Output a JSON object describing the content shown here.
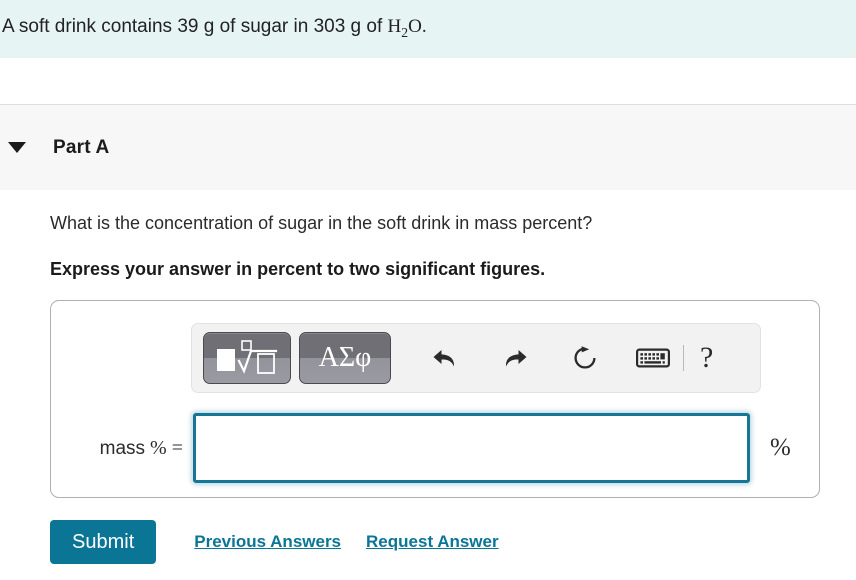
{
  "problem": {
    "text_before": "A soft drink contains 39 g of sugar in 303 g of ",
    "formula_h": "H",
    "formula_sub": "2",
    "formula_o": "O.",
    "full_text": "A soft drink contains 39 g of sugar in 303 g of H2O.",
    "sugar_mass_g": 39,
    "water_mass_g": 303,
    "banner_color": "#e7f4f4"
  },
  "part": {
    "title": "Part A",
    "toggle_icon": "triangle-down-icon",
    "expanded": true,
    "header_color": "#f7f7f7"
  },
  "question": {
    "prompt": "What is the concentration of sugar in the soft drink in mass percent?",
    "instruction": "Express your answer in percent to two significant figures."
  },
  "toolbar": {
    "template_button_icon": "math-template-icon",
    "greek_button_label": "ΑΣφ",
    "icons": [
      {
        "name": "undo-icon",
        "label": "undo"
      },
      {
        "name": "redo-icon",
        "label": "redo"
      },
      {
        "name": "reset-icon",
        "label": "reset"
      },
      {
        "name": "keyboard-icon",
        "label": "keyboard"
      }
    ],
    "divider": true,
    "help_label": "?"
  },
  "answer": {
    "label_mass": "mass",
    "label_percent_eq": "% =",
    "input_value": "",
    "input_placeholder": "",
    "unit": "%",
    "focused": true,
    "focus_border_color": "#177595"
  },
  "actions": {
    "submit_label": "Submit",
    "previous_answers_label": "Previous Answers",
    "request_answer_label": "Request Answer",
    "accent_color": "#0b7596"
  }
}
